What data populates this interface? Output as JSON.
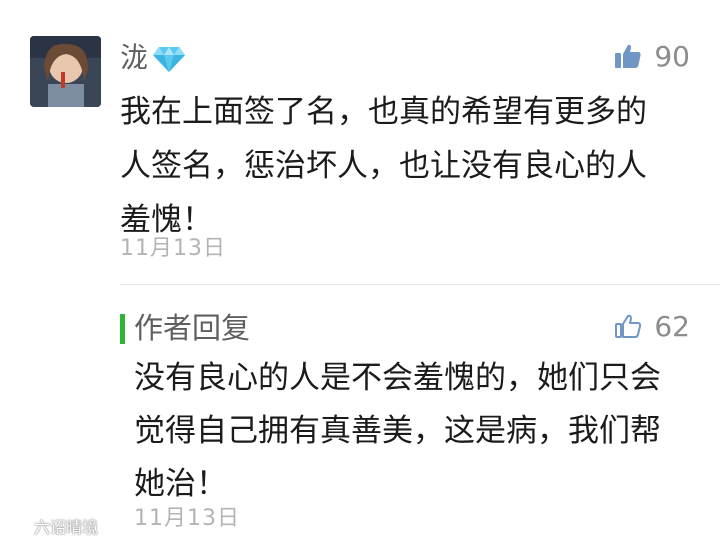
{
  "comment": {
    "avatar_icon": "user-avatar",
    "username": "泷",
    "badge_icon": "diamond-icon",
    "like_icon": "thumbs-up-filled-icon",
    "likes": "90",
    "text": "我在上面签了名，也真的希望有更多的\n人签名，惩治坏人，也让没有良心的人\n羞愧！",
    "date": "11月13日"
  },
  "reply": {
    "author": "作者回复",
    "like_icon": "thumbs-up-outline-icon",
    "likes": "62",
    "text": "没有良心的人是不会羞愧的，她们只会\n觉得自己拥有真善美，这是病，我们帮\n她治！",
    "date": "11月13日"
  },
  "colors": {
    "accent_green": "#2fb533",
    "thumb_blue": "#6f96c4",
    "date_gray": "#b4b4b4"
  },
  "watermark": {
    "text": "六诏晴境"
  }
}
